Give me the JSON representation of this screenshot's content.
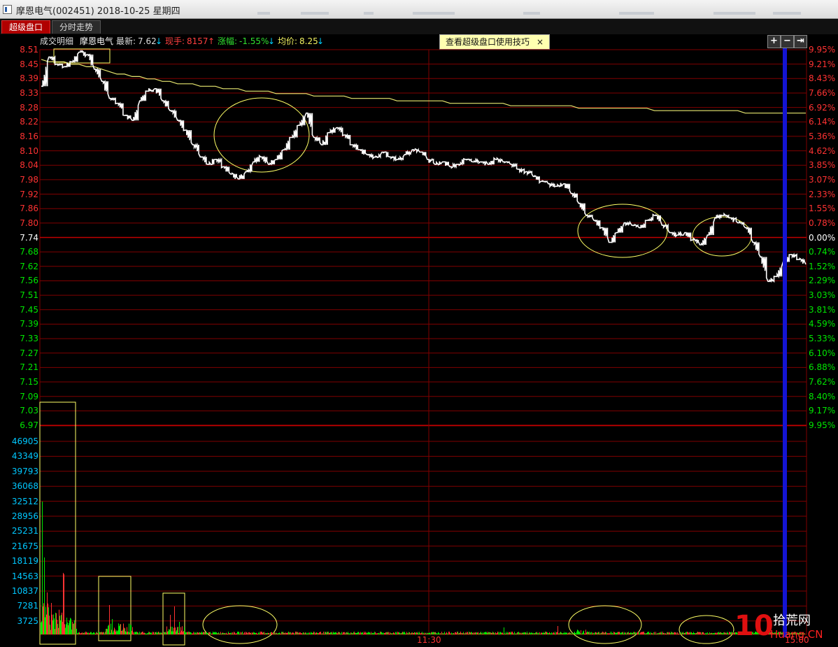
{
  "window": {
    "title": "摩恩电气(002451) 2018-10-25 星期四"
  },
  "tabs": [
    {
      "label": "超级盘口",
      "active": true
    },
    {
      "label": "分时走势",
      "active": false
    }
  ],
  "info": {
    "trades_label": "成交明细",
    "stock_name": "摩恩电气",
    "latest_label": "最新:",
    "latest_value": "7.62",
    "latest_arrow": "↓",
    "hand_label": "现手:",
    "hand_value": "8157",
    "hand_arrow": "↑",
    "change_label": "涨幅:",
    "change_value": "-1.55%",
    "change_arrow": "↓",
    "avg_label": "均价:",
    "avg_value": "8.25",
    "avg_arrow": "↓"
  },
  "tip": {
    "label": "查看超级盘口使用技巧",
    "close": "×"
  },
  "controls": [
    {
      "icon": "plus-icon",
      "glyph": "+"
    },
    {
      "icon": "minus-icon",
      "glyph": "−"
    },
    {
      "icon": "exit-right-icon",
      "glyph": "⇥"
    }
  ],
  "colors": {
    "up": "#ff3232",
    "down": "#00e600",
    "flat": "#ffffff",
    "grid": "#800000",
    "avg": "#e8e870",
    "volume_axis": "#00c8ff",
    "cursor": "#1414d2",
    "annotation": "#ffff66"
  },
  "price_axis": {
    "prev_close": 7.74,
    "labels": [
      "8.51",
      "8.45",
      "8.39",
      "8.33",
      "8.28",
      "8.22",
      "8.16",
      "8.10",
      "8.04",
      "7.98",
      "7.92",
      "7.86",
      "7.80",
      "7.74",
      "7.68",
      "7.62",
      "7.56",
      "7.51",
      "7.45",
      "7.39",
      "7.33",
      "7.27",
      "7.21",
      "7.15",
      "7.09",
      "7.03",
      "6.97"
    ]
  },
  "pct_axis": {
    "labels": [
      "9.95%",
      "9.21%",
      "8.43%",
      "7.66%",
      "6.92%",
      "6.14%",
      "5.36%",
      "4.62%",
      "3.85%",
      "3.07%",
      "2.33%",
      "1.55%",
      "0.78%",
      "0.00%",
      "0.74%",
      "1.52%",
      "2.29%",
      "3.03%",
      "3.81%",
      "4.59%",
      "5.33%",
      "6.10%",
      "6.88%",
      "7.62%",
      "8.40%",
      "9.17%",
      "9.95%"
    ]
  },
  "volume_axis": {
    "labels": [
      "46905",
      "43349",
      "39793",
      "36068",
      "32512",
      "28956",
      "25231",
      "21675",
      "18119",
      "14563",
      "10837",
      "7281",
      "3725"
    ]
  },
  "time_axis": {
    "labels": [
      "11:30",
      "15:00"
    ]
  },
  "watermark": {
    "num": "10",
    "cn": "拾荒网",
    "en": "Huang.CN"
  },
  "chart_data": {
    "type": "line",
    "title": "",
    "xlabel": "",
    "ylabel": "",
    "ylim": [
      6.97,
      8.51
    ],
    "x_ticks": [
      "11:30",
      "15:00"
    ],
    "prev_close": 7.74,
    "series": [
      {
        "values": [
          8.36,
          8.48,
          8.45,
          8.44,
          8.46,
          8.5,
          8.49,
          8.43,
          8.38,
          8.31,
          8.29,
          8.24,
          8.22,
          8.3,
          8.34,
          8.35,
          8.3,
          8.26,
          8.22,
          8.18,
          8.12,
          8.07,
          8.04,
          8.06,
          8.03,
          8.0,
          7.98,
          8.01,
          8.05,
          8.07,
          8.04,
          8.06,
          8.1,
          8.15,
          8.2,
          8.25,
          8.15,
          8.12,
          8.17,
          8.19,
          8.16,
          8.12,
          8.1,
          8.08,
          8.07,
          8.09,
          8.07,
          8.06,
          8.08,
          8.1,
          8.09,
          8.06,
          8.04,
          8.05,
          8.03,
          8.04,
          8.06,
          8.05,
          8.05,
          8.04,
          8.06,
          8.05,
          8.04,
          8.02,
          8.01,
          7.99,
          7.97,
          7.96,
          7.95,
          7.96,
          7.92,
          7.88,
          7.83,
          7.81,
          7.78,
          7.72,
          7.76,
          7.8,
          7.79,
          7.78,
          7.81,
          7.83,
          7.79,
          7.76,
          7.75,
          7.76,
          7.73,
          7.71,
          7.75,
          7.82,
          7.83,
          7.82,
          7.8,
          7.78,
          7.72,
          7.66,
          7.56,
          7.58,
          7.64,
          7.67,
          7.65,
          7.63
        ]
      },
      {
        "values": [
          8.47,
          8.46,
          8.46,
          8.46,
          8.45,
          8.45,
          8.44,
          8.44,
          8.43,
          8.42,
          8.41,
          8.41,
          8.4,
          8.4,
          8.39,
          8.39,
          8.38,
          8.38,
          8.37,
          8.37,
          8.37,
          8.36,
          8.36,
          8.36,
          8.35,
          8.35,
          8.35,
          8.34,
          8.34,
          8.34,
          8.34,
          8.33,
          8.33,
          8.33,
          8.33,
          8.33,
          8.32,
          8.32,
          8.32,
          8.32,
          8.32,
          8.31,
          8.31,
          8.31,
          8.31,
          8.31,
          8.31,
          8.3,
          8.3,
          8.3,
          8.3,
          8.3,
          8.3,
          8.3,
          8.29,
          8.29,
          8.29,
          8.29,
          8.29,
          8.29,
          8.29,
          8.29,
          8.28,
          8.28,
          8.28,
          8.28,
          8.28,
          8.28,
          8.28,
          8.28,
          8.28,
          8.27,
          8.27,
          8.27,
          8.27,
          8.27,
          8.27,
          8.27,
          8.27,
          8.27,
          8.27,
          8.26,
          8.26,
          8.26,
          8.26,
          8.26,
          8.26,
          8.26,
          8.26,
          8.26,
          8.26,
          8.26,
          8.26,
          8.25,
          8.25,
          8.25,
          8.25,
          8.25,
          8.25,
          8.25,
          8.25,
          8.25
        ]
      }
    ]
  }
}
